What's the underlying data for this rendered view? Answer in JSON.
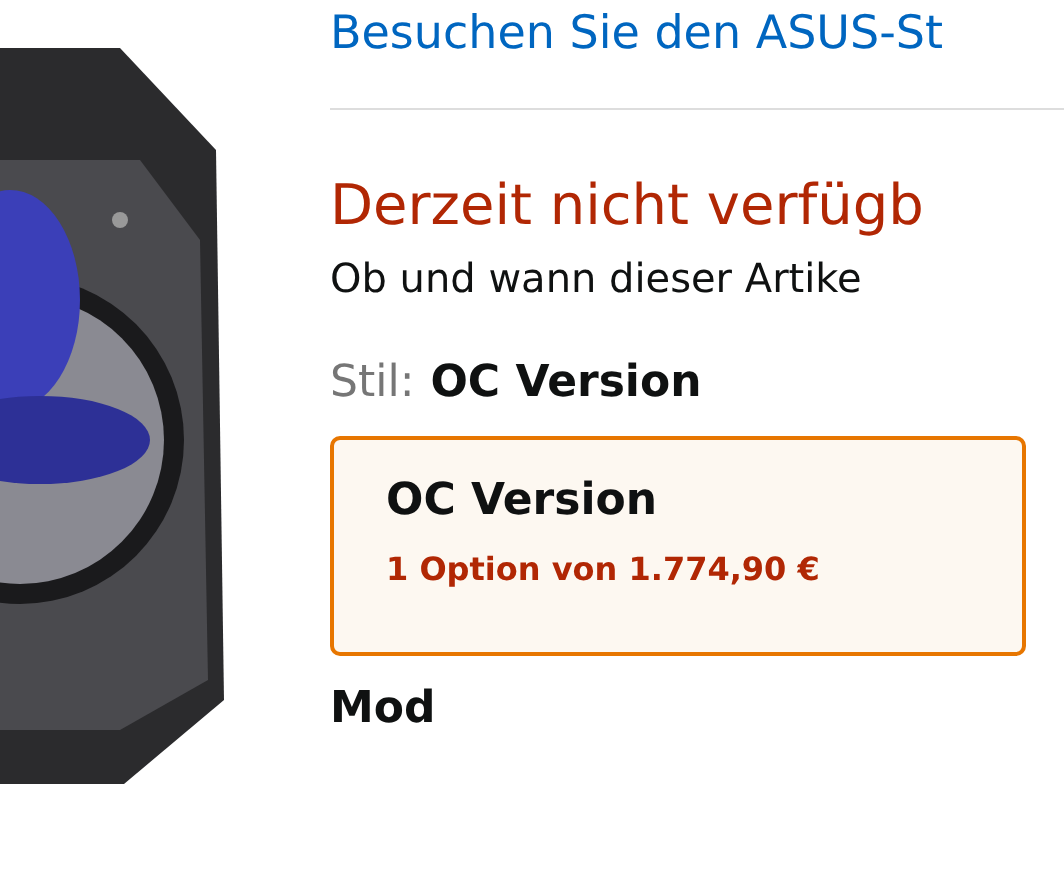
{
  "store_link": "Besuchen Sie den ASUS-St",
  "availability": {
    "status": "Derzeit nicht verfügb",
    "note": "Ob und wann dieser Artike"
  },
  "style": {
    "label": "Stil:",
    "value": "OC Version"
  },
  "options": [
    {
      "name": "OC Version",
      "offer": "1 Option von 1.774,90 €",
      "selected": true
    }
  ],
  "next_heading": "Mod"
}
